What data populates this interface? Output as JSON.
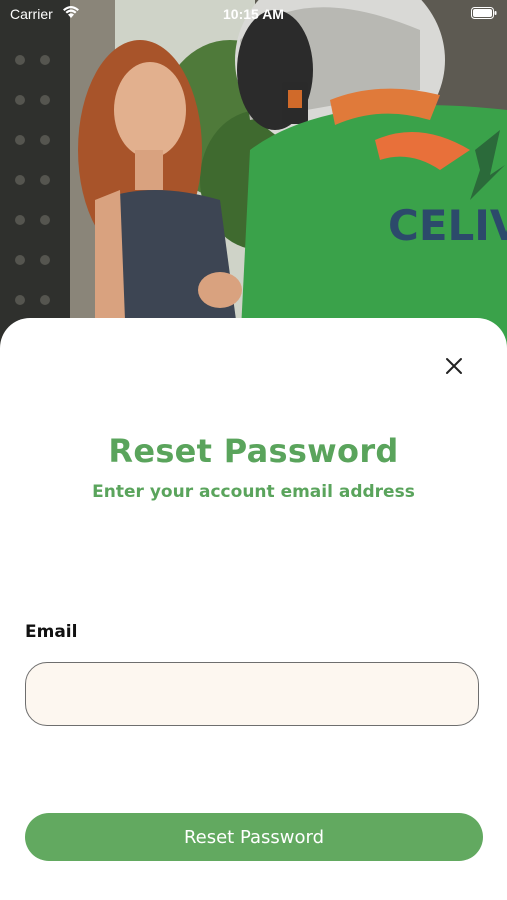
{
  "status_bar": {
    "carrier": "Carrier",
    "time": "10:15 AM",
    "icons": [
      "wifi-icon",
      "battery-icon"
    ]
  },
  "hero": {
    "logo_text": "CELIV"
  },
  "sheet": {
    "close_icon": "close-icon",
    "title": "Reset Password",
    "subtitle": "Enter your account email address",
    "email_label": "Email",
    "email_value": "",
    "email_placeholder": "",
    "submit_label": "Reset Password"
  },
  "colors": {
    "accent": "#5aa45c",
    "button": "#62a960",
    "field_background": "#fdf7f0"
  }
}
